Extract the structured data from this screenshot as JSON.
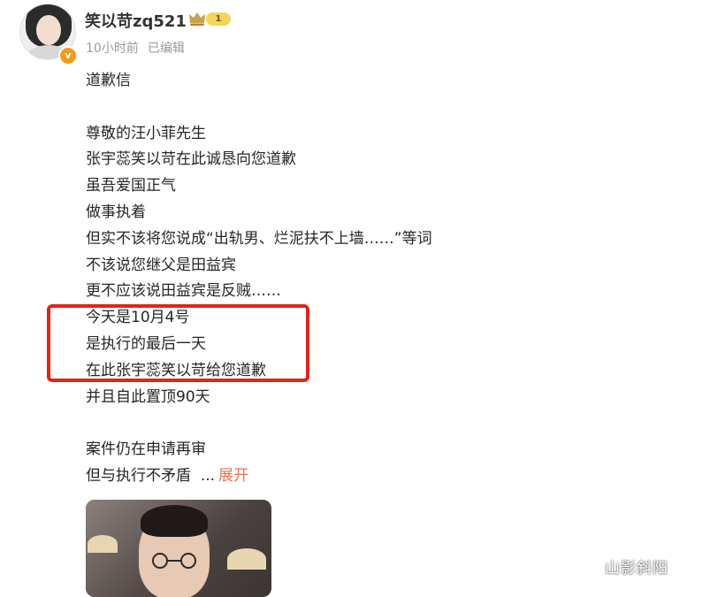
{
  "post": {
    "username": "笑以苛zq521",
    "level_badge": "1",
    "verified_mark": "v",
    "time": "10小时前",
    "edited": "已编辑",
    "lines": [
      "道歉信",
      "",
      "尊敬的汪小菲先生",
      "张宇蕊笑以苛在此诚恳向您道歉",
      "虽吾爱国正气",
      "做事执着",
      "但实不该将您说成“出轨男、烂泥扶不上墙……”等词",
      "不该说您继父是田益宾",
      "更不应该说田益宾是反贼……",
      "今天是10月4号",
      "是执行的最后一天",
      "在此张宇蕊笑以苛给您道歉",
      "并且自此置顶90天",
      "",
      "案件仍在申请再审"
    ],
    "last_line": "但与执行不矛盾",
    "ellipsis": "...",
    "expand_label": "展开"
  },
  "watermark": "山影斜阳",
  "colors": {
    "highlight": "#e1251b",
    "link": "#eb7350",
    "meta": "#999999",
    "verified": "#f29c1f",
    "crown": "#c8a24a"
  },
  "icons": {
    "verified": "verified-badge-icon",
    "crown": "crown-icon"
  }
}
